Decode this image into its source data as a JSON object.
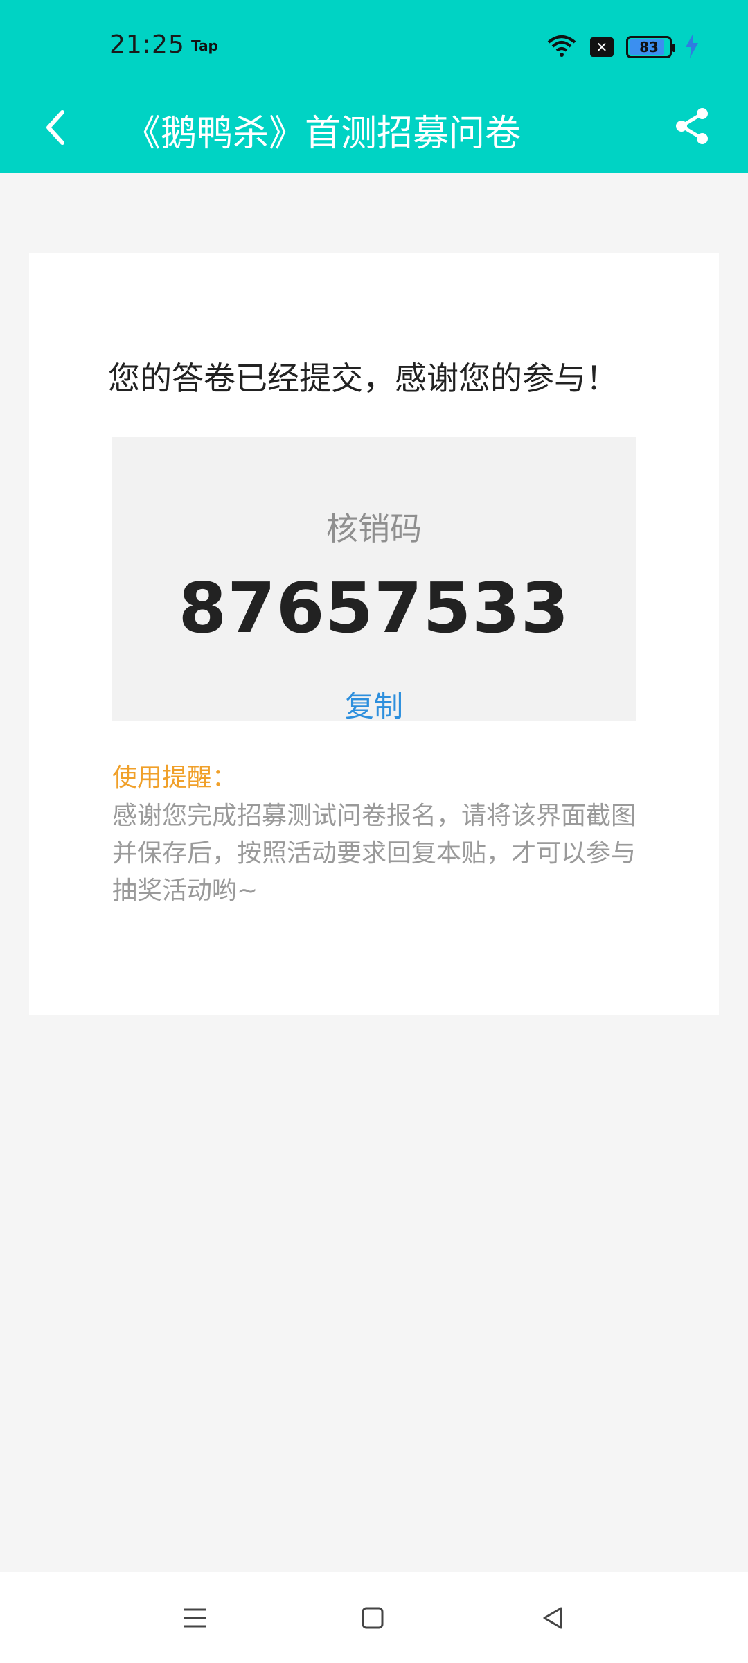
{
  "status_bar": {
    "time": "21:25",
    "app_tag": "Tap",
    "battery_percent": "83",
    "notification_icon": "x-box-icon"
  },
  "app_bar": {
    "title": "《鹅鸭杀》首测招募问卷"
  },
  "content": {
    "headline": "您的答卷已经提交，感谢您的参与！",
    "code_label": "核销码",
    "code_value": "87657533",
    "copy_label": "复制",
    "reminder_title": "使用提醒：",
    "reminder_text": "感谢您完成招募测试问卷报名，请将该界面截图并保存后，按照活动要求回复本贴，才可以参与抽奖活动哟~"
  },
  "colors": {
    "accent": "#00d3c4",
    "link": "#2d8fdd",
    "warning": "#f0a02a"
  },
  "icons": [
    "wifi-icon",
    "battery-icon",
    "charging-icon",
    "back-arrow-icon",
    "share-icon",
    "menu-icon",
    "home-icon",
    "back-triangle-icon"
  ]
}
